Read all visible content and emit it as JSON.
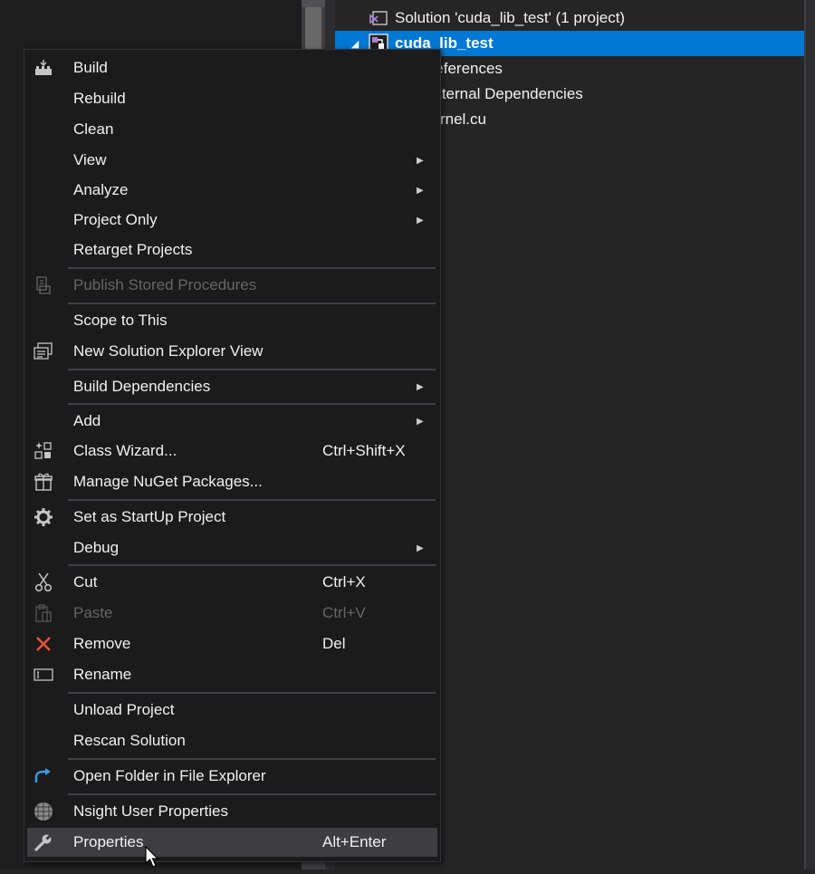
{
  "solution_explorer": {
    "solution_label": "Solution 'cuda_lib_test' (1 project)",
    "project_label": "cuda_lib_test",
    "children": [
      "References",
      "External Dependencies",
      "kernel.cu"
    ]
  },
  "colors": {
    "selection": "#0078d4",
    "menu_bg": "#1b1b1c",
    "disabled_text": "#656565",
    "remove_icon": "#e8503a",
    "folder_icon": "#3d9be9"
  },
  "context_menu": {
    "items": [
      {
        "label": "Build",
        "shortcut": "",
        "icon": "build-icon"
      },
      {
        "label": "Rebuild",
        "shortcut": ""
      },
      {
        "label": "Clean",
        "shortcut": ""
      },
      {
        "label": "View",
        "shortcut": "",
        "submenu": true
      },
      {
        "label": "Analyze",
        "shortcut": "",
        "submenu": true
      },
      {
        "label": "Project Only",
        "shortcut": "",
        "submenu": true
      },
      {
        "label": "Retarget Projects",
        "shortcut": ""
      },
      {
        "label": "Publish Stored Procedures",
        "shortcut": "",
        "disabled": true,
        "icon": "publish-icon"
      },
      {
        "label": "Scope to This",
        "shortcut": ""
      },
      {
        "label": "New Solution Explorer View",
        "shortcut": "",
        "icon": "new-view-icon"
      },
      {
        "label": "Build Dependencies",
        "shortcut": "",
        "submenu": true
      },
      {
        "label": "Add",
        "shortcut": "",
        "submenu": true
      },
      {
        "label": "Class Wizard...",
        "shortcut": "Ctrl+Shift+X",
        "icon": "class-wizard-icon"
      },
      {
        "label": "Manage NuGet Packages...",
        "shortcut": "",
        "icon": "nuget-gift-icon"
      },
      {
        "label": "Set as StartUp Project",
        "shortcut": "",
        "icon": "gear-icon"
      },
      {
        "label": "Debug",
        "shortcut": "",
        "submenu": true
      },
      {
        "label": "Cut",
        "shortcut": "Ctrl+X",
        "icon": "scissors-icon"
      },
      {
        "label": "Paste",
        "shortcut": "Ctrl+V",
        "disabled": true,
        "icon": "clipboard-icon"
      },
      {
        "label": "Remove",
        "shortcut": "Del",
        "icon": "remove-x-icon"
      },
      {
        "label": "Rename",
        "shortcut": "",
        "icon": "rename-icon"
      },
      {
        "label": "Unload Project",
        "shortcut": ""
      },
      {
        "label": "Rescan Solution",
        "shortcut": ""
      },
      {
        "label": "Open Folder in File Explorer",
        "shortcut": "",
        "icon": "open-folder-arrow-icon"
      },
      {
        "label": "Nsight User Properties",
        "shortcut": "",
        "icon": "nsight-globe-icon"
      },
      {
        "label": "Properties",
        "shortcut": "Alt+Enter",
        "icon": "wrench-icon",
        "hovered": true
      }
    ]
  }
}
